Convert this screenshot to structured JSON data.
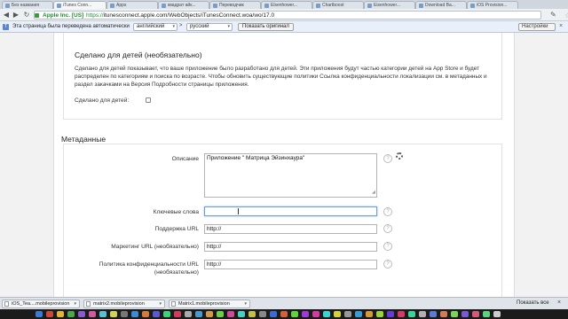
{
  "browser": {
    "tabs": [
      {
        "title": "Без названия",
        "active": false
      },
      {
        "title": "iTunes Conn...",
        "active": true
      },
      {
        "title": "Apps",
        "active": false
      },
      {
        "title": "квадрат айк...",
        "active": false
      },
      {
        "title": "Переводчик",
        "active": false
      },
      {
        "title": "Elsenhower...",
        "active": false
      },
      {
        "title": "Chartboost",
        "active": false
      },
      {
        "title": "Eisenhower...",
        "active": false
      },
      {
        "title": "Download Ba...",
        "active": false
      },
      {
        "title": "iOS Provision...",
        "active": false
      }
    ],
    "ev_badge": "Apple Inc. [US]",
    "url_protocol": "https://",
    "url_rest": "itunesconnect.apple.com/WebObjects/iTunesConnect.woa/wo/17.0"
  },
  "translate_bar": {
    "message": "Эта страница была переведена автоматически",
    "from_lang": "английский",
    "arrow": ">",
    "to_lang": "русский",
    "show_original": "Показать оригинал",
    "settings": "Настройки",
    "close": "×"
  },
  "kids_section": {
    "title": "Сделано для детей (необязательно)",
    "description": "Сделано для детей показывает, что ваше приложение было разработано для детей. Эти приложения будут частью категории детей на App Store и будет распределен по категориям и поиска по возрасте. Чтобы обновить существующие политики Ссылка конфиденциальности локализации см. в метаданных и раздел закачками на Версия Подробности страницы приложения.",
    "checkbox_label": "Сделано для детей:",
    "checked": false
  },
  "metadata": {
    "title": "Метаданные",
    "description_label": "Описание",
    "description_value": "Приложение \" Матрица Эйзинхаура\"",
    "keywords_label": "Ключевые слова",
    "keywords_value": "",
    "support_url_label": "Поддержка URL",
    "support_url_value": "http://",
    "marketing_url_label": "Маркетинг URL (необязательно)",
    "marketing_url_value": "http://",
    "privacy_url_label_line1": "Политика конфиденциальности URL",
    "privacy_url_label_line2": "(необязательно)",
    "privacy_url_value": "http://",
    "help_glyph": "?"
  },
  "downloads": {
    "items": [
      "iOS_Tea....mobileprovision",
      "matrix2.mobileprovision",
      "Matrix1.mobileprovision"
    ],
    "show_all": "Показать все",
    "close": "×"
  },
  "colors": {
    "ev_green": "#1f8f2f",
    "translate_bar_bg": "#eaf0fb",
    "focus_blue": "#6e9ee0"
  }
}
